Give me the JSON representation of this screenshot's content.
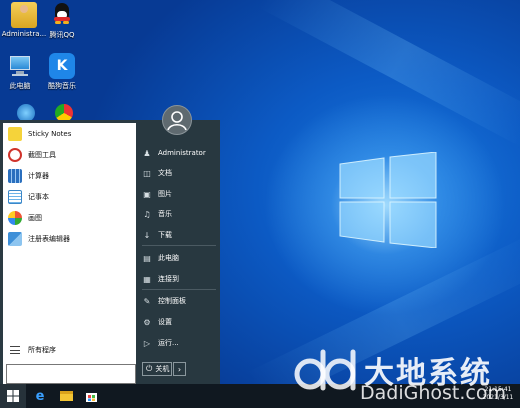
{
  "desktop": {
    "icons": [
      {
        "label": "Administra...",
        "icon": "user-folder-icon"
      },
      {
        "label": "腾讯QQ",
        "icon": "qq-icon"
      },
      {
        "label": "此电脑",
        "icon": "computer-icon"
      },
      {
        "label": "酷狗音乐",
        "icon": "kugou-icon"
      }
    ]
  },
  "start_menu": {
    "apps": [
      {
        "label": "Sticky Notes",
        "icon": "sticky-notes-icon"
      },
      {
        "label": "截图工具",
        "icon": "snipping-tool-icon"
      },
      {
        "label": "计算器",
        "icon": "calculator-icon"
      },
      {
        "label": "记事本",
        "icon": "notepad-icon"
      },
      {
        "label": "画图",
        "icon": "paint-icon"
      },
      {
        "label": "注册表编辑器",
        "icon": "registry-editor-icon"
      }
    ],
    "all_programs": "所有程序",
    "right_items": [
      {
        "label": "Administrator",
        "icon": "user-icon"
      },
      {
        "label": "文档",
        "icon": "document-icon"
      },
      {
        "label": "图片",
        "icon": "picture-icon"
      },
      {
        "label": "音乐",
        "icon": "music-icon"
      },
      {
        "label": "下载",
        "icon": "download-icon"
      },
      {
        "label": "此电脑",
        "icon": "computer-icon"
      },
      {
        "label": "连接到",
        "icon": "connect-icon"
      },
      {
        "label": "控制面板",
        "icon": "control-panel-icon"
      },
      {
        "label": "设置",
        "icon": "gear-icon"
      },
      {
        "label": "运行...",
        "icon": "run-icon"
      }
    ],
    "shutdown_label": "关机"
  },
  "taskbar": {
    "icons": [
      "windows-start-icon",
      "edge-icon",
      "file-explorer-icon",
      "store-icon"
    ],
    "time": "21:15:41",
    "date": "2021/3/11"
  },
  "watermark": {
    "logo_text": "大地系统",
    "sub_text": "DadiGhost.com"
  },
  "colors": {
    "accent": "#0c5ac4",
    "menu_dark": "#283840",
    "taskbar": "#101820"
  }
}
